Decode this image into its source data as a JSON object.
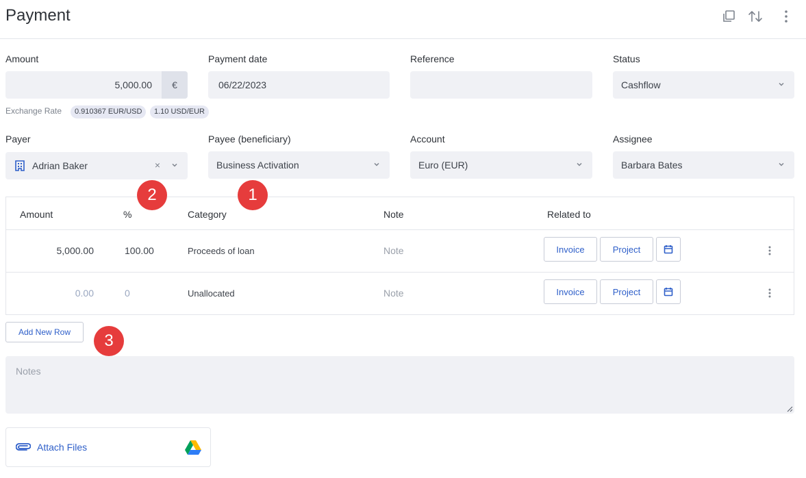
{
  "header": {
    "title": "Payment",
    "icons": [
      "copy-icon",
      "sort-arrows-icon",
      "more-vertical-icon"
    ]
  },
  "form": {
    "amount": {
      "label": "Amount",
      "value": "5,000.00",
      "currency_symbol": "€"
    },
    "payment_date": {
      "label": "Payment date",
      "value": "06/22/2023"
    },
    "reference": {
      "label": "Reference",
      "value": ""
    },
    "status": {
      "label": "Status",
      "value": "Cashflow"
    },
    "exchange_rate": {
      "label": "Exchange Rate",
      "rate1": "0.910367 EUR/USD",
      "rate2": "1.10 USD/EUR"
    },
    "payer": {
      "label": "Payer",
      "value": "Adrian Baker",
      "clear": "×"
    },
    "payee": {
      "label": "Payee (beneficiary)",
      "value": "Business Activation"
    },
    "account": {
      "label": "Account",
      "value": "Euro (EUR)"
    },
    "assignee": {
      "label": "Assignee",
      "value": "Barbara Bates"
    }
  },
  "badges": [
    "1",
    "2",
    "3"
  ],
  "table": {
    "headers": {
      "amount": "Amount",
      "percent": "%",
      "category": "Category",
      "note": "Note",
      "related": "Related to"
    },
    "rows": [
      {
        "amount": "5,000.00",
        "percent": "100.00",
        "category": "Proceeds of loan",
        "note": "Note",
        "invoice": "Invoice",
        "project": "Project"
      },
      {
        "amount": "0.00",
        "percent": "0",
        "category": "Unallocated",
        "note": "Note",
        "invoice": "Invoice",
        "project": "Project"
      }
    ]
  },
  "add_row_label": "Add New Row",
  "notes_placeholder": "Notes",
  "attach_label": "Attach Files",
  "colors": {
    "accent": "#2e5fc9",
    "badge": "#e63c3c",
    "field_bg": "#f0f1f5"
  }
}
